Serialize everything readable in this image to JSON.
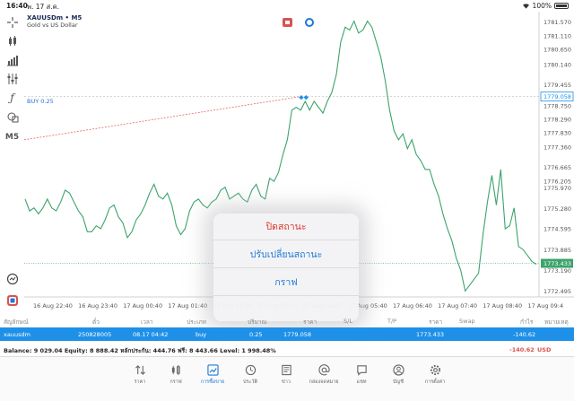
{
  "status_bar": {
    "time": "16:40",
    "date": "พ. 17 ส.ค.",
    "battery": "100%"
  },
  "chart": {
    "symbol": "XAUUSDm • M5",
    "description": "Gold vs US Dollar",
    "order_label": "BUY 0.25",
    "left_tools": [
      "crosshair-icon",
      "candles-icon",
      "bars-icon",
      "indicators-icon",
      "function-icon",
      "objects-icon",
      "timeframe"
    ],
    "timeframe": "M5",
    "colors": {
      "price_line": "#3da36b",
      "order_line": "#e05555",
      "bid_line": "#3da36b",
      "buy_line": "#aaaaaa",
      "accent": "#1e90e8"
    }
  },
  "chart_data": {
    "type": "line",
    "x_ticks": [
      "16 Aug 22:40",
      "16 Aug 23:40",
      "17 Aug 00:40",
      "17 Aug 01:40",
      "17 Aug 02:40",
      "17 Aug 03:40",
      "17 Aug 04:40",
      "17 Aug 05:40",
      "17 Aug 06:40",
      "17 Aug 07:40",
      "17 Aug 08:40",
      "17 Aug 09:4"
    ],
    "y_ticks": [
      "1781.570",
      "1781.110",
      "1780.650",
      "1780.140",
      "1779.455",
      "1779.058",
      "1778.750",
      "1778.290",
      "1777.830",
      "1777.360",
      "1776.665",
      "1776.205",
      "1775.970",
      "1775.280",
      "1774.595",
      "1773.885",
      "1773.433",
      "1773.190",
      "1772.495"
    ],
    "ylim": [
      1772.3,
      1781.8
    ],
    "buy_price": 1779.058,
    "bid_price": 1773.433,
    "bid_label": "1773.433",
    "buy_label_price": "1779.058",
    "series": [
      {
        "values": [
          1775.6,
          1775.2,
          1775.3,
          1775.1,
          1775.3,
          1775.6,
          1775.3,
          1775.2,
          1775.5,
          1775.9,
          1775.8,
          1775.5,
          1775.2,
          1775.0,
          1774.5,
          1774.5,
          1774.7,
          1774.6,
          1774.9,
          1775.3,
          1775.4,
          1775.0,
          1774.8,
          1774.3,
          1774.5,
          1774.9,
          1775.1,
          1775.4,
          1775.8,
          1776.1,
          1775.7,
          1775.6,
          1775.8,
          1775.4,
          1774.7,
          1774.4,
          1774.6,
          1775.2,
          1775.5,
          1775.6,
          1775.4,
          1775.3,
          1775.5,
          1775.6,
          1775.9,
          1776.0,
          1775.6,
          1775.7,
          1775.8,
          1775.6,
          1775.5,
          1775.9,
          1776.1,
          1775.7,
          1775.6,
          1776.3,
          1776.2,
          1776.5,
          1777.1,
          1777.6,
          1778.6,
          1778.7,
          1778.6,
          1778.9,
          1778.6,
          1778.9,
          1778.7,
          1778.5,
          1778.9,
          1779.2,
          1779.8,
          1780.9,
          1781.4,
          1781.3,
          1781.6,
          1781.2,
          1781.3,
          1781.6,
          1781.4,
          1780.9,
          1780.4,
          1779.6,
          1778.6,
          1777.9,
          1777.6,
          1777.8,
          1777.3,
          1777.6,
          1777.1,
          1776.9,
          1776.6,
          1776.6,
          1776.1,
          1775.7,
          1775.1,
          1774.6,
          1774.2,
          1773.6,
          1773.2,
          1772.5,
          1772.7,
          1772.9,
          1773.1,
          1774.4,
          1775.5,
          1776.4,
          1775.4,
          1776.6,
          1774.6,
          1774.7,
          1775.3,
          1774.0,
          1773.9,
          1773.7,
          1773.5,
          1773.4
        ]
      }
    ]
  },
  "context_menu": {
    "items": [
      {
        "label": "ปิดสถานะ",
        "color": "#e0352d"
      },
      {
        "label": "ปรับเปลี่ยนสถานะ",
        "color": "#1e78d8"
      },
      {
        "label": "กราฟ",
        "color": "#1e78d8"
      }
    ]
  },
  "table": {
    "headers": [
      "สัญลักษณ์",
      "ตั๋ว",
      "เวลา",
      "ประเภท",
      "ปริมาณ",
      "ราคา",
      "S/L",
      "T/P",
      "ราคา",
      "Swap",
      "กำไร",
      "หมายเหตุ"
    ],
    "row": {
      "symbol": "xauusdm",
      "ticket": "250828005",
      "time": "08.17 04:42",
      "type": "buy",
      "volume": "0.25",
      "open_price": "1779.058",
      "current_price": "1773.433",
      "profit": "-140.62"
    }
  },
  "balance": {
    "text": "Balance: 9 029.04 Equity: 8 888.42 หลักประกัน: 444.76 ฟรี: 8 443.66 Level: 1 998.48%",
    "profit": "-140.62",
    "currency": "USD"
  },
  "tabs": [
    {
      "label": "ราคา",
      "icon": "quotes-icon"
    },
    {
      "label": "กราฟ",
      "icon": "chart-icon"
    },
    {
      "label": "การซื้อขาย",
      "icon": "trade-icon",
      "active": true
    },
    {
      "label": "ประวัติ",
      "icon": "history-icon"
    },
    {
      "label": "ข่าว",
      "icon": "news-icon"
    },
    {
      "label": "กล่องจดหมาย",
      "icon": "mailbox-icon"
    },
    {
      "label": "แชท",
      "icon": "chat-icon"
    },
    {
      "label": "บัญชี",
      "icon": "account-icon"
    },
    {
      "label": "การตั้งค่า",
      "icon": "settings-icon"
    }
  ]
}
